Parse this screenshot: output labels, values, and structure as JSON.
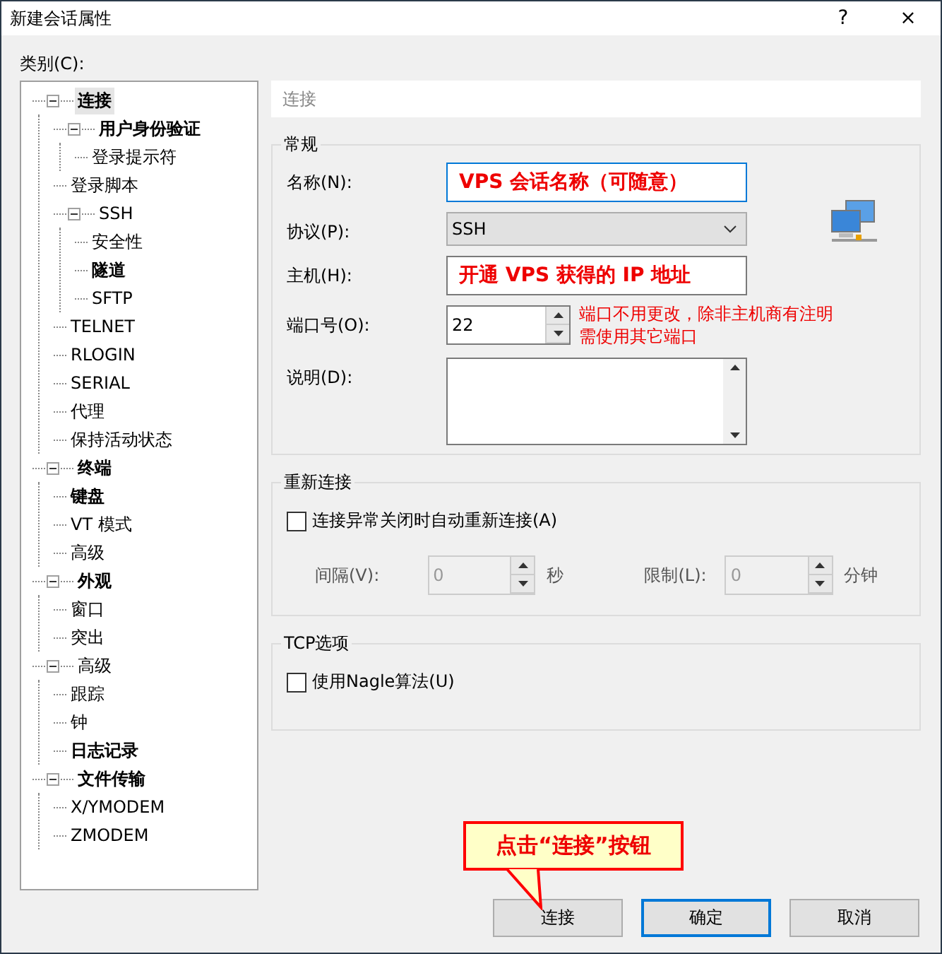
{
  "window": {
    "title": "新建会话属性",
    "help": "?",
    "close": "×"
  },
  "category_label": "类别(C):",
  "tree": [
    {
      "label": "连接",
      "bold": true,
      "selected": true,
      "expanded": true,
      "children": [
        {
          "label": "用户身份验证",
          "bold": true,
          "selected": false,
          "expanded": true,
          "children": [
            {
              "label": "登录提示符",
              "bold": false,
              "selected": false
            }
          ]
        },
        {
          "label": "登录脚本",
          "bold": false,
          "selected": false
        },
        {
          "label": "SSH",
          "bold": false,
          "selected": false,
          "expanded": true,
          "children": [
            {
              "label": "安全性",
              "bold": false,
              "selected": false
            },
            {
              "label": "隧道",
              "bold": true,
              "selected": false
            },
            {
              "label": "SFTP",
              "bold": false,
              "selected": false
            }
          ]
        },
        {
          "label": "TELNET",
          "bold": false,
          "selected": false
        },
        {
          "label": "RLOGIN",
          "bold": false,
          "selected": false
        },
        {
          "label": "SERIAL",
          "bold": false,
          "selected": false
        },
        {
          "label": "代理",
          "bold": false,
          "selected": false
        },
        {
          "label": "保持活动状态",
          "bold": false,
          "selected": false
        }
      ]
    },
    {
      "label": "终端",
      "bold": true,
      "selected": false,
      "expanded": true,
      "children": [
        {
          "label": "键盘",
          "bold": true,
          "selected": false
        },
        {
          "label": "VT 模式",
          "bold": false,
          "selected": false
        },
        {
          "label": "高级",
          "bold": false,
          "selected": false
        }
      ]
    },
    {
      "label": "外观",
      "bold": true,
      "selected": false,
      "expanded": true,
      "children": [
        {
          "label": "窗口",
          "bold": false,
          "selected": false
        },
        {
          "label": "突出",
          "bold": false,
          "selected": false
        }
      ]
    },
    {
      "label": "高级",
      "bold": false,
      "selected": false,
      "expanded": true,
      "children": [
        {
          "label": "跟踪",
          "bold": false,
          "selected": false
        },
        {
          "label": "钟",
          "bold": false,
          "selected": false
        },
        {
          "label": "日志记录",
          "bold": true,
          "selected": false
        }
      ]
    },
    {
      "label": "文件传输",
      "bold": true,
      "selected": false,
      "expanded": true,
      "children": [
        {
          "label": "X/YMODEM",
          "bold": false,
          "selected": false
        },
        {
          "label": "ZMODEM",
          "bold": false,
          "selected": false
        }
      ]
    }
  ],
  "page_title": "连接",
  "general": {
    "title": "常规",
    "name": {
      "label": "名称(N):",
      "value": "VPS 会话名称（可随意）"
    },
    "protocol": {
      "label": "协议(P):",
      "value": "SSH"
    },
    "host": {
      "label": "主机(H):",
      "value": "开通 VPS 获得的 IP 地址"
    },
    "port": {
      "label": "端口号(O):",
      "value": "22",
      "note": "端口不用更改，除非主机商有注明需使用其它端口"
    },
    "description": {
      "label": "说明(D):"
    }
  },
  "reconnect": {
    "title": "重新连接",
    "checkbox": {
      "label": "连接异常关闭时自动重新连接(A)",
      "checked": false
    },
    "interval": {
      "label": "间隔(V):",
      "value": "0",
      "unit": "秒"
    },
    "limit": {
      "label": "限制(L):",
      "value": "0",
      "unit": "分钟"
    }
  },
  "tcp": {
    "title": "TCP选项",
    "checkbox": {
      "label": "使用Nagle算法(U)",
      "checked": false
    }
  },
  "callout": "点击“连接”按钮",
  "buttons": [
    {
      "label": "连接",
      "selected": false
    },
    {
      "label": "确定",
      "selected": true
    },
    {
      "label": "取消",
      "selected": false
    }
  ]
}
